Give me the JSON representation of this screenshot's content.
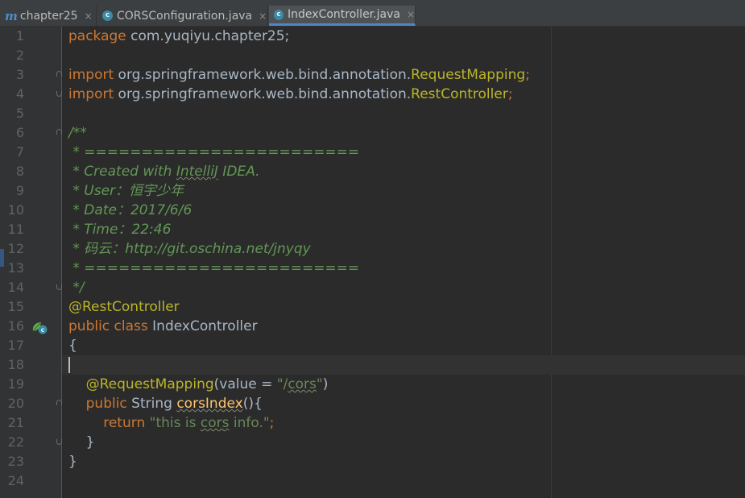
{
  "tabs": [
    {
      "label": "chapter25",
      "icon": "module-m-icon",
      "active": false
    },
    {
      "label": "CORSConfiguration.java",
      "icon": "java-class-icon",
      "active": false
    },
    {
      "label": "IndexController.java",
      "icon": "java-class-icon",
      "active": true
    }
  ],
  "tab_close_glyph": "×",
  "class_icon_letter": "c",
  "module_icon_letter": "m",
  "line_numbers": [
    "1",
    "2",
    "3",
    "4",
    "5",
    "6",
    "7",
    "8",
    "9",
    "10",
    "11",
    "12",
    "13",
    "14",
    "15",
    "16",
    "17",
    "18",
    "19",
    "20",
    "21",
    "22",
    "23",
    "24"
  ],
  "code": {
    "l1_kw": "package",
    "l1_rest": " com.yuqiyu.chapter25;",
    "l3_kw": "import",
    "l3_pkg": " org.springframework.web.bind.annotation.",
    "l3_cls": "RequestMapping",
    "l3_semi": ";",
    "l4_kw": "import",
    "l4_pkg": " org.springframework.web.bind.annotation.",
    "l4_cls": "RestController",
    "l4_semi": ";",
    "l6": "/**",
    "l7": " * ========================",
    "l8_a": " * Created with ",
    "l8_b": "IntelliJ",
    "l8_c": " IDEA.",
    "l9": " * User：恒宇少年",
    "l10": " * Date：2017/6/6",
    "l11": " * Time：22:46",
    "l12": " * 码云：http://git.oschina.net/jnyqy",
    "l13": " * ========================",
    "l14": " */",
    "l15": "@RestController",
    "l16_kw": "public class",
    "l16_rest": " IndexController",
    "l17": "{",
    "l19_indent": "    ",
    "l19_ann": "@RequestMapping",
    "l19_a": "(value = ",
    "l19_q1": "\"/",
    "l19_cors": "cors",
    "l19_q2": "\"",
    "l19_b": ")",
    "l20_indent": "    ",
    "l20_kw": "public",
    "l20_type": " String ",
    "l20_fn": "corsIndex",
    "l20_rest": "(){",
    "l21_indent": "        ",
    "l21_kw": "return",
    "l21_s1": " \"this is ",
    "l21_cors": "cors",
    "l21_s2": " info.\"",
    "l21_semi": ";",
    "l22": "    }",
    "l23": "}"
  },
  "colors": {
    "background": "#2b2b2b",
    "gutter": "#313335",
    "keyword": "#cc7832",
    "annotation": "#bbb529",
    "string": "#6a8759",
    "doc_comment": "#629755",
    "method": "#ffc66d",
    "plain": "#a9b7c6",
    "line_number": "#606366",
    "active_tab_underline": "#4a88c7"
  }
}
